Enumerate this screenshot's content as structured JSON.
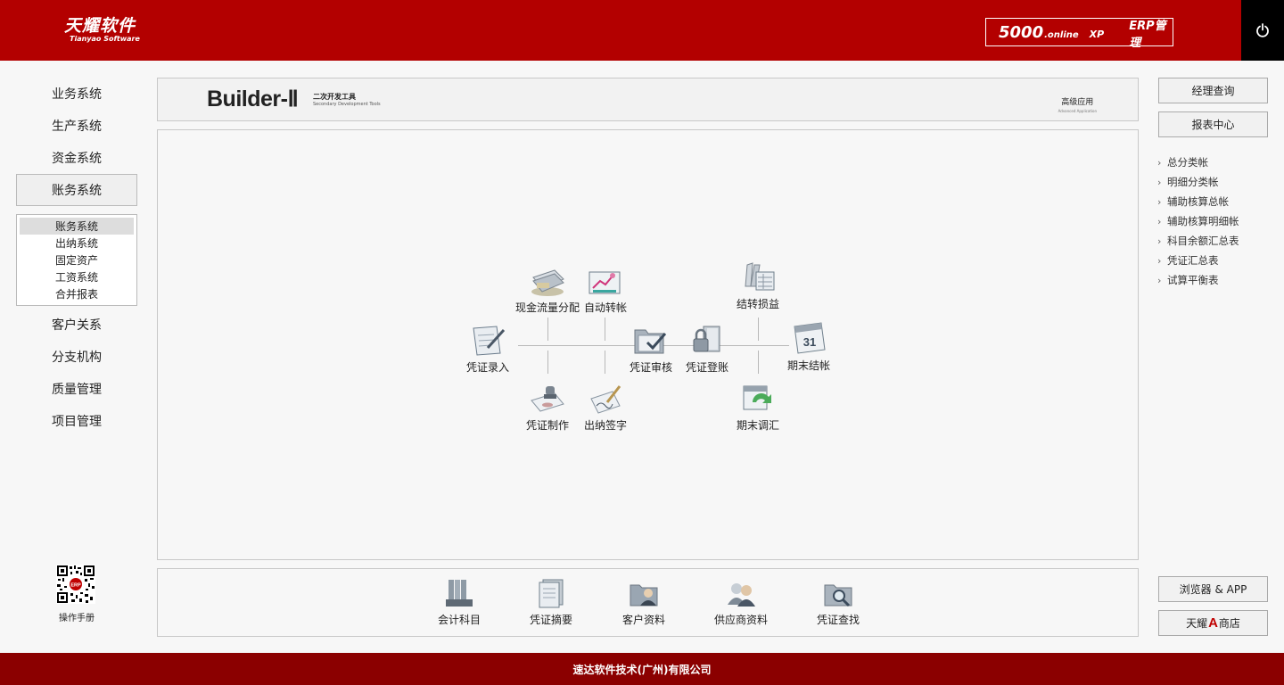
{
  "header": {
    "logo_cn": "天耀软件",
    "logo_en": "Tianyao Software",
    "product_num": "5000",
    "product_online": ".online",
    "product_xp": "XP",
    "product_erp": "ERP管理",
    "power_icon": "power-icon"
  },
  "nav": {
    "items": [
      "业务系统",
      "生产系统",
      "资金系统",
      "账务系统",
      "客户关系",
      "分支机构",
      "质量管理",
      "项目管理"
    ],
    "active": "账务系统",
    "subitems": [
      "账务系统",
      "出纳系统",
      "固定资产",
      "工资系统",
      "合并报表"
    ],
    "active_sub": "账务系统",
    "manual_label": "操作手册"
  },
  "banner": {
    "title": "Builder-Ⅱ",
    "subtitle_cn": "二次开发工具",
    "subtitle_en": "Secondary Development Tools",
    "adv_cn": "高级应用",
    "adv_en": "Advanced Application"
  },
  "flow": {
    "voucher_entry": "凭证录入",
    "cashflow": "现金流量分配",
    "auto_transfer": "自动转帐",
    "voucher_make": "凭证制作",
    "cashier_sign": "出纳签字",
    "voucher_audit": "凭证审核",
    "voucher_post": "凭证登账",
    "carry_pl": "结转损益",
    "period_adjust": "期末调汇",
    "period_close": "期末结帐",
    "calendar_day": "31"
  },
  "tools": [
    "会计科目",
    "凭证摘要",
    "客户资料",
    "供应商资料",
    "凭证查找"
  ],
  "right": {
    "manager_query": "经理查询",
    "report_center": "报表中心",
    "links": [
      "总分类帐",
      "明细分类帐",
      "辅助核算总帐",
      "辅助核算明细帐",
      "科目余额汇总表",
      "凭证汇总表",
      "试算平衡表"
    ],
    "browser_app": "浏览器 & APP",
    "store_pre": "天耀",
    "store_a": "A",
    "store_post": "商店"
  },
  "footer": {
    "company": "速达软件技术(广州)有限公司"
  },
  "colors": {
    "header": "#b30000",
    "footer": "#8b0000",
    "power_bg": "#000000"
  }
}
